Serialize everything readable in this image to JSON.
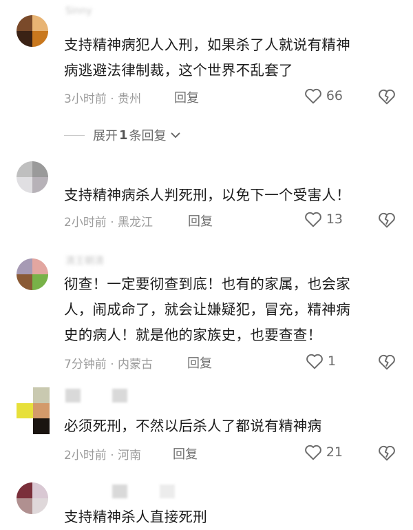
{
  "comments": [
    {
      "username": "Sinny",
      "text_lines": [
        "支持精神病犯人入刑，如果杀了人就说有精神",
        "病逃避法律制裁，这个世界不乱套了"
      ],
      "meta": "3小时前 · 贵州",
      "reply_label": "回复",
      "likes": "66",
      "expand": {
        "prefix": "展开",
        "count": "1",
        "suffix": "条回复"
      },
      "avatar_colors": [
        "#7a4a2a",
        "#e8b474",
        "#3a2215",
        "#c9781e"
      ]
    },
    {
      "username": "",
      "text_lines": [
        "支持精神病杀人判死刑，以免下一个受害人！"
      ],
      "meta": "2小时前 · 黑龙江",
      "reply_label": "回复",
      "likes": "13",
      "avatar_colors": [
        "#bfbfbf",
        "#9a9a9a",
        "#e0dfe2",
        "#b7b2b8"
      ]
    },
    {
      "username": "清王朝清",
      "text_lines": [
        "彻查！一定要彻查到底！也有的家属，也会家",
        "人，闹成命了，就会让嫌疑犯，冒充，精神病",
        "史的病人！就是他的家族史，也要查查！"
      ],
      "meta": "7分钟前 · 内蒙古",
      "reply_label": "回复",
      "likes": "1",
      "avatar_colors": [
        "#a69ab4",
        "#e2a6a0",
        "#8a5a35",
        "#78b248"
      ]
    },
    {
      "username": "",
      "text_lines": [
        "必须死刑，不然以后杀人了都说有精神病"
      ],
      "meta": "2小时前 · 河南",
      "reply_label": "回复",
      "likes": "21",
      "avatar_colors": [
        "#e9e4b8",
        "#c9c9b0",
        "#e7e03a",
        "#1a1410"
      ]
    },
    {
      "username": "",
      "text_lines": [
        "支持精神杀人直接死刑"
      ],
      "avatar_colors": [
        "#7a2f3a",
        "#d9c8d3",
        "#b09090",
        "#dfd8da"
      ]
    }
  ],
  "icons": {
    "like": "heart-outline-icon",
    "dislike": "broken-heart-icon",
    "expand": "chevron-down-icon"
  },
  "colors": {
    "text": "#1b1b1b",
    "meta": "#9b9b9b",
    "icon": "#6b6b6b"
  }
}
